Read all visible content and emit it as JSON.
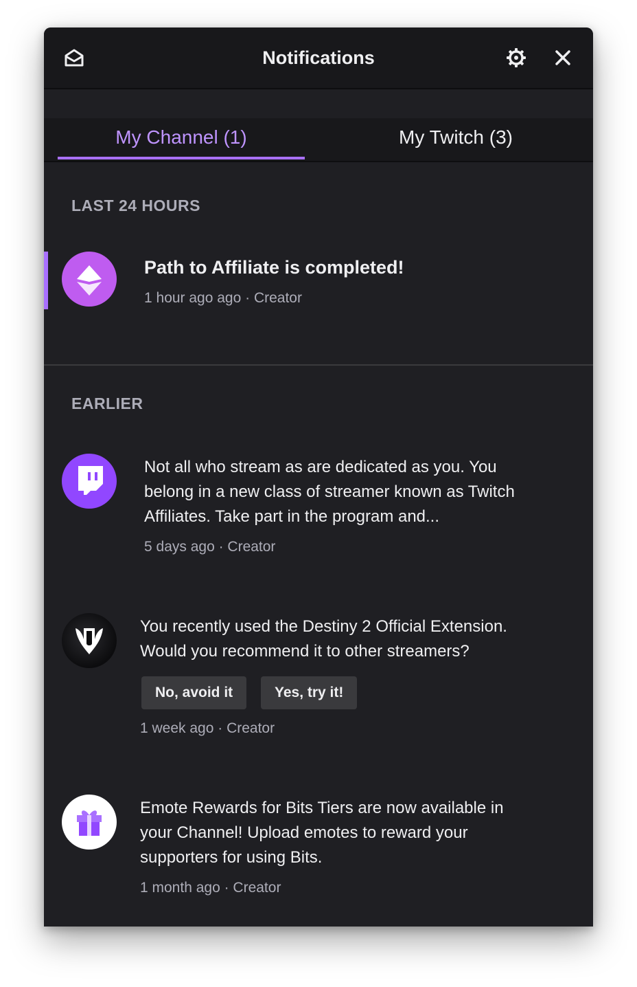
{
  "header": {
    "title": "Notifications",
    "inbox_icon": "envelope-open-icon",
    "settings_icon": "gear-icon",
    "close_icon": "close-icon"
  },
  "tabs": [
    {
      "label": "My Channel (1)",
      "active": true
    },
    {
      "label": "My Twitch (3)",
      "active": false
    }
  ],
  "sections": {
    "recent_label": "LAST 24 HOURS",
    "earlier_label": "EARLIER"
  },
  "notifications": [
    {
      "icon": "affiliate-badge-icon",
      "title": "Path to Affiliate is completed!",
      "meta": "1 hour ago ago · Creator",
      "unread": true
    },
    {
      "icon": "twitch-glitch-icon",
      "text": "Not all who stream as are dedicated as you. You belong in a new class of streamer known as Twitch Affiliates. Take part in the program and...",
      "meta": "5 days ago · Creator"
    },
    {
      "icon": "destiny-logo-icon",
      "text": "You recently used the Destiny 2 Official Extension. Would you recommend it to other streamers?",
      "actions": [
        "No, avoid it",
        "Yes, try it!"
      ],
      "meta": "1 week ago · Creator"
    },
    {
      "icon": "gift-icon",
      "text": "Emote Rewards for Bits Tiers are now available in your Channel! Upload emotes to reward your supporters for using Bits.",
      "meta": "1 month ago · Creator"
    }
  ],
  "colors": {
    "accent": "#a970ff",
    "accent_text": "#bf94ff",
    "panel_bg": "#1f1f23",
    "header_bg": "#18181b"
  }
}
